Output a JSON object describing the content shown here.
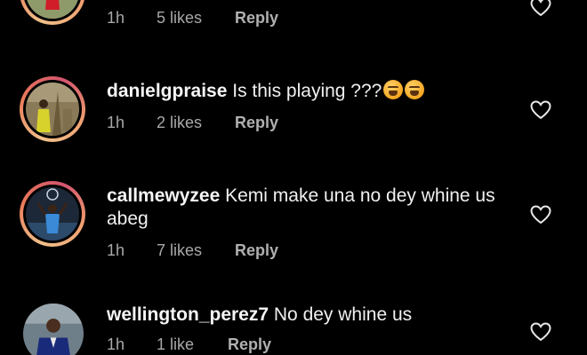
{
  "comments": [
    {
      "username": "",
      "text": "",
      "time": "1h",
      "likes": "5 likes",
      "reply": "Reply",
      "avatar_icon": "avatar-red-figure",
      "story_ring": true
    },
    {
      "username": "danielgpraise",
      "text": "Is this playing ???",
      "emojis": [
        "tired-face-emoji",
        "tired-face-emoji"
      ],
      "time": "1h",
      "likes": "2 likes",
      "reply": "Reply",
      "avatar_icon": "avatar-outdoor-figure",
      "story_ring": true
    },
    {
      "username": "callmewyzee",
      "text": "Kemi make una no dey whine us abeg",
      "time": "1h",
      "likes": "7 likes",
      "reply": "Reply",
      "avatar_icon": "avatar-blue-figure",
      "story_ring": true
    },
    {
      "username": "wellington_perez7",
      "text": "No dey whine us",
      "time": "1h",
      "likes": "1 like",
      "reply": "Reply",
      "avatar_icon": "avatar-suit-figure",
      "story_ring": false
    }
  ],
  "colors": {
    "background": "#000000",
    "text": "#f5f5f5",
    "meta": "#a8a8a8",
    "ring_gradient": [
      "#f0c08a",
      "#e97a5a",
      "#d3546e"
    ]
  },
  "icons": {
    "like": "heart-outline-icon"
  }
}
